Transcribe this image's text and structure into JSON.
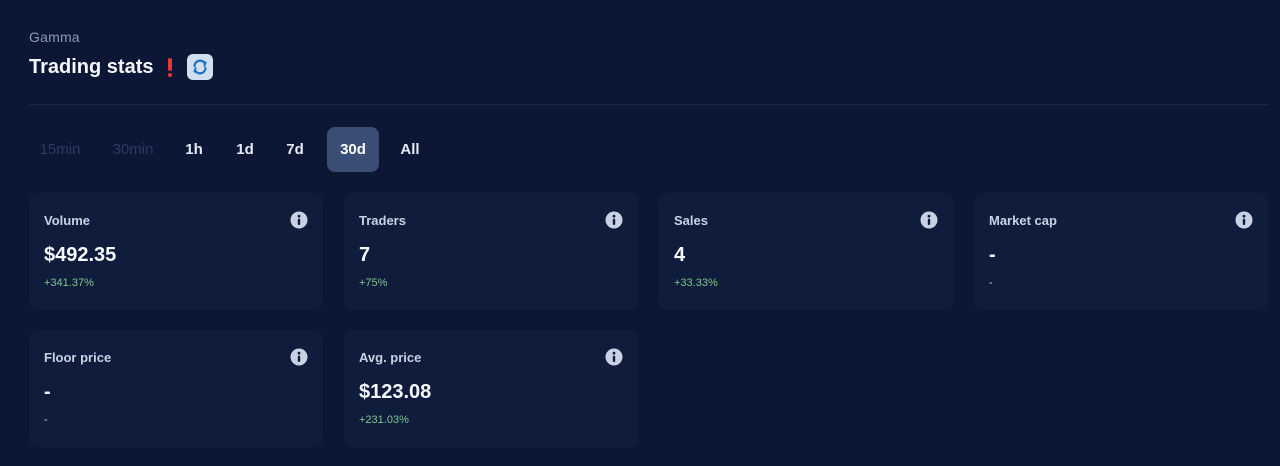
{
  "header": {
    "collection_name": "Gamma",
    "title": "Trading stats",
    "alert_icon": "exclamation-icon",
    "refresh_icon": "refresh-icon"
  },
  "tabs": [
    {
      "label": "15min",
      "state": "disabled"
    },
    {
      "label": "30min",
      "state": "disabled"
    },
    {
      "label": "1h",
      "state": "normal"
    },
    {
      "label": "1d",
      "state": "normal"
    },
    {
      "label": "7d",
      "state": "normal"
    },
    {
      "label": "30d",
      "state": "active"
    },
    {
      "label": "All",
      "state": "normal"
    }
  ],
  "stats": [
    {
      "label": "Volume",
      "value": "$492.35",
      "change": "+341.37%"
    },
    {
      "label": "Traders",
      "value": "7",
      "change": "+75%"
    },
    {
      "label": "Sales",
      "value": "4",
      "change": "+33.33%"
    },
    {
      "label": "Market cap",
      "value": "-",
      "change": "-"
    },
    {
      "label": "Floor price",
      "value": "-",
      "change": "-"
    },
    {
      "label": "Avg. price",
      "value": "$123.08",
      "change": "+231.03%"
    }
  ],
  "colors": {
    "background": "#0b1735",
    "card": "#0f1c3c",
    "active_tab": "#3a4d75",
    "positive": "#7fc78b",
    "alert": "#e53935"
  }
}
